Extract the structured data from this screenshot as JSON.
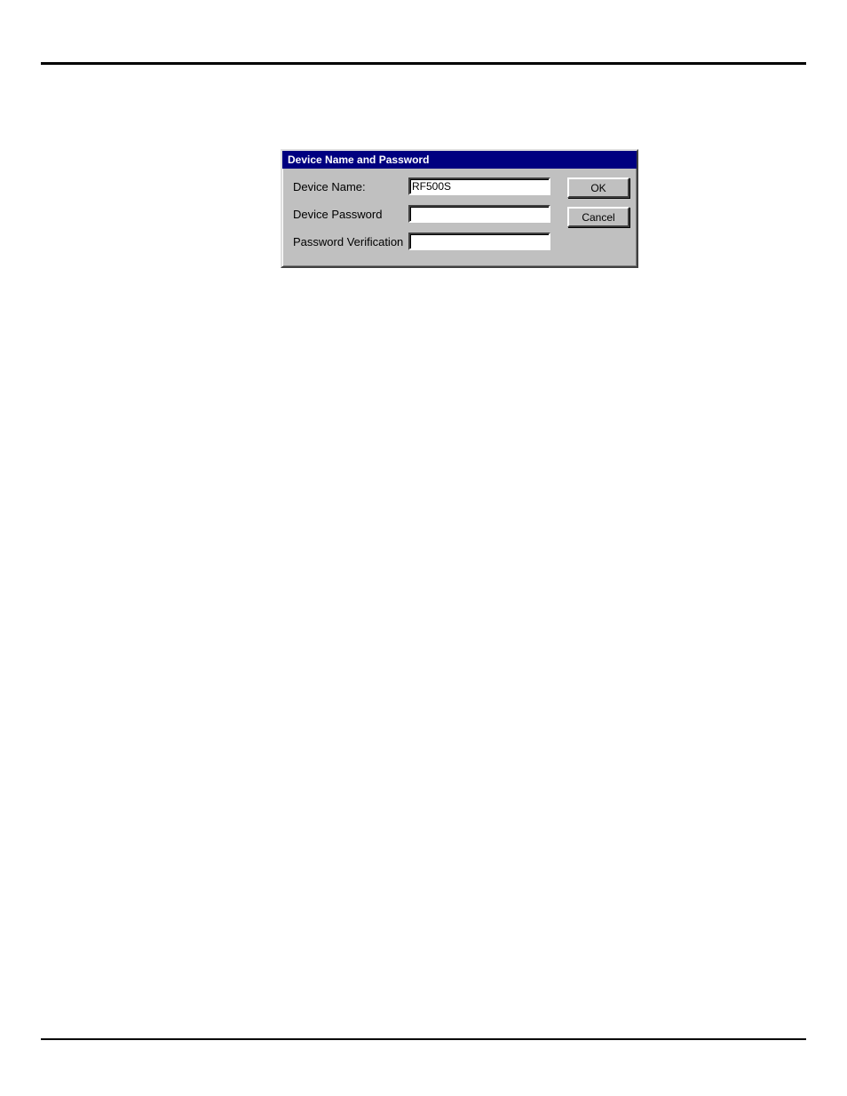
{
  "dialog": {
    "title": "Device Name and Password",
    "fields": {
      "device_name": {
        "label": "Device Name:",
        "value": "RF500S"
      },
      "device_password": {
        "label": "Device Password",
        "value": ""
      },
      "password_verification": {
        "label": "Password Verification",
        "value": ""
      }
    },
    "buttons": {
      "ok": "OK",
      "cancel": "Cancel"
    }
  }
}
